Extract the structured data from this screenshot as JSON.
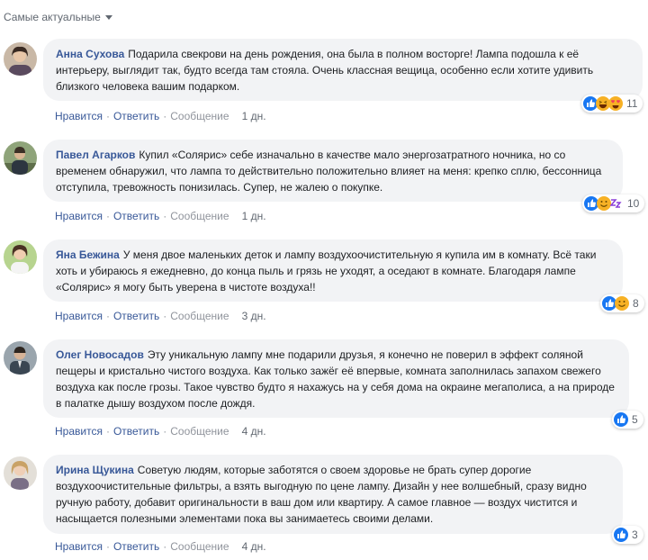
{
  "sort": {
    "label": "Самые актуальные"
  },
  "actions": {
    "like": "Нравится",
    "reply": "Ответить",
    "message": "Сообщение",
    "sep": "·"
  },
  "comments": [
    {
      "author": "Анна Сухова",
      "text": "Подарила свекрови на день рождения, она была в полном восторге! Лампа подошла к её интерьеру, выглядит так, будто всегда там стояла. Очень классная вещица, особенно если хотите удивить близкого человека вашим подарком.",
      "time": "1 дн.",
      "reactions": [
        "like-icon",
        "haha-icon",
        "love-eyes-icon"
      ],
      "count": "11"
    },
    {
      "author": "Павел Агарков",
      "text": "Купил «Солярис» себе изначально в качестве мало энергозатратного ночника, но со временем обнаружил, что лампа то действительно положительно влияет на меня: крепко сплю, бессонница отступила, тревожность понизилась. Супер, не жалею о покупке.",
      "time": "1 дн.",
      "reactions": [
        "like-icon",
        "smile-icon",
        "sleep-zzz-icon"
      ],
      "count": "10"
    },
    {
      "author": "Яна Бежина",
      "text": "У меня двое маленьких деток и лампу воздухоочистительную я купила им в комнату. Всё таки хоть и убираюсь я ежедневно, до конца пыль и грязь не уходят, а оседают в комнате. Благодаря лампе «Солярис» я могу быть уверена в чистоте воздуха!!",
      "time": "3 дн.",
      "reactions": [
        "like-icon",
        "smile-icon"
      ],
      "count": "8"
    },
    {
      "author": "Олег Новосадов",
      "text": "Эту уникальную лампу мне подарили друзья, я конечно не поверил в эффект соляной пещеры и кристально чистого воздуха. Как только зажёг её впервые, комната заполнилась запахом свежего воздуха как после грозы. Такое чувство будто я нахажусь на у себя дома на окраине мегаполиса, а на природе в палатке дышу воздухом после дождя.",
      "time": "4 дн.",
      "reactions": [
        "like-icon"
      ],
      "count": "5"
    },
    {
      "author": "Ирина Щукина",
      "text": "Советую людям, которые заботятся о своем здоровье не брать супер дорогие воздухоочистительные фильтры, а взять выгодную по цене лампу. Дизайн у нее волшебный, сразу видно ручную работу, добавит оригинальности в ваш дом или квартиру. А самое главное — воздух чистится и насыщается полезными элементами пока вы занимаетесь своими делами.",
      "time": "4 дн.",
      "reactions": [
        "like-icon"
      ],
      "count": "3"
    }
  ],
  "colors": {
    "link": "#385898",
    "bubble": "#f2f3f5",
    "like": "#1877f2",
    "love": "#f33e58",
    "emoji": "#f7b125"
  }
}
